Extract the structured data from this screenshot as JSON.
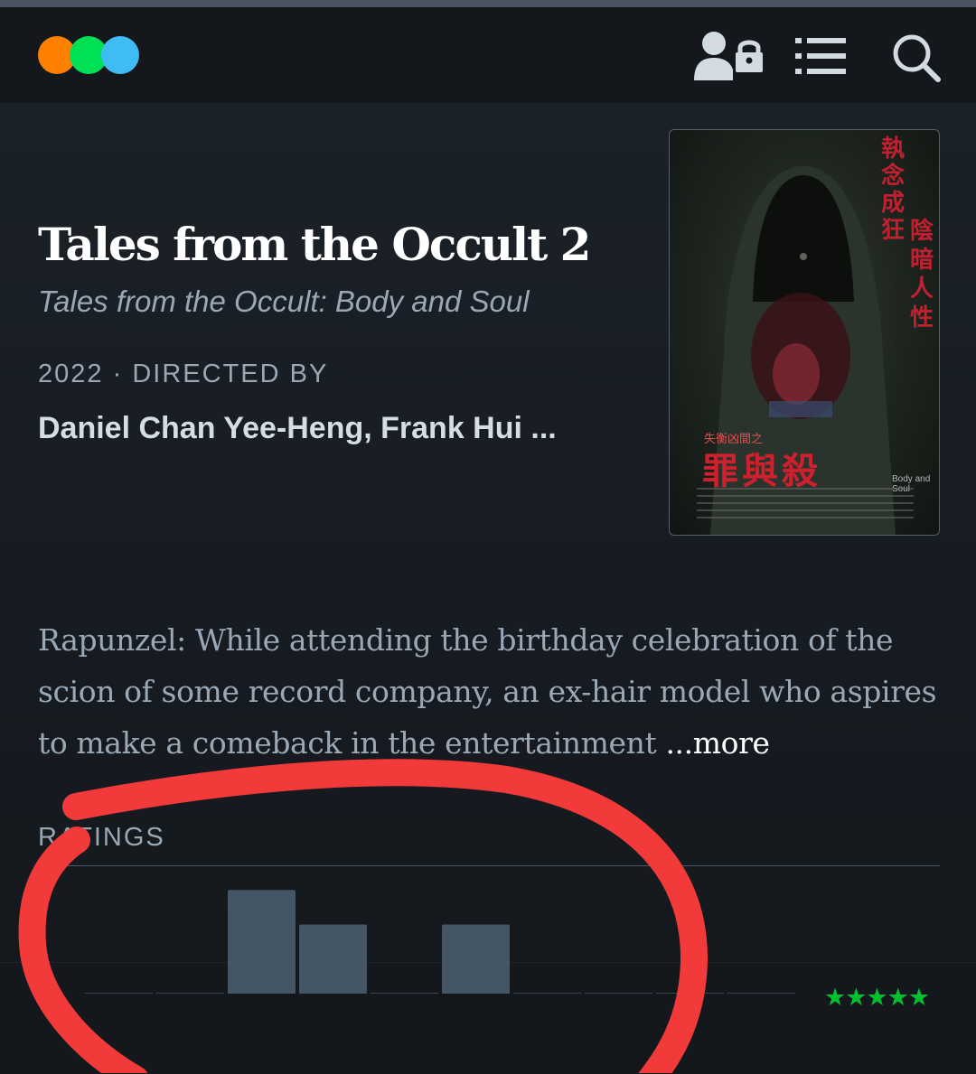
{
  "header": {
    "logo_name": "letterboxd-logo",
    "logo_colors": [
      "#ff8000",
      "#00e054",
      "#40bcf4"
    ],
    "icons": [
      "account-lock-icon",
      "menu-list-icon",
      "search-icon"
    ]
  },
  "film": {
    "title": "Tales from the Occult 2",
    "original_title": "Tales from the Occult: Body and Soul",
    "year": "2022",
    "separator": "·",
    "directed_by_label": "DIRECTED BY",
    "directors": "Daniel Chan Yee-Heng, Frank Hui ...",
    "poster": {
      "title_cn": "罪與殺",
      "series_cn": "失衡凶間之",
      "tagline_vertical_1": "執念成狂",
      "tagline_vertical_2": "陰暗人性",
      "subtitle_en": "Body and Soul"
    },
    "synopsis": "Rapunzel: While attending the birthday celebration of the scion of some record company, an ex-hair model who aspires to make a comeback in the entertainment",
    "more_label": "...more"
  },
  "ratings": {
    "label": "RATINGS",
    "histogram": [
      0,
      0,
      0.75,
      0.5,
      0,
      0.5,
      0,
      0,
      0,
      0,
      0
    ],
    "low_stars": "★",
    "high_stars": "★★★★★",
    "star_color": "#00c030",
    "bar_color": "#445566"
  },
  "annotation_color": "#f23a3a"
}
